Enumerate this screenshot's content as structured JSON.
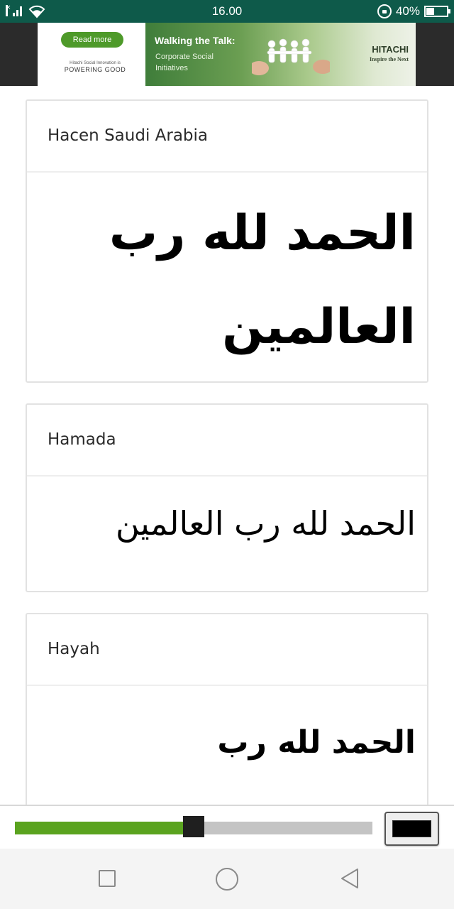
{
  "status_bar": {
    "time": "16.00",
    "battery_percent": "40%",
    "battery_level": 0.4,
    "icons": [
      "signal-icon",
      "wifi-icon",
      "rotation-lock-icon",
      "battery-icon"
    ]
  },
  "ad": {
    "read_more": "Read more",
    "tagline": "Hitachi Social Innovation is",
    "powering": "POWERING GOOD",
    "headline": "Walking the Talk:",
    "subline": "Corporate Social Initiatives",
    "brand": "HITACHI",
    "brand_tag": "Inspire the Next"
  },
  "cards": [
    {
      "title": "Hacen Saudi Arabia",
      "sample": "الحمد لله رب العالمين"
    },
    {
      "title": "Hamada",
      "sample": "الحمد لله رب العالمين"
    },
    {
      "title": "Hayah",
      "sample": "الحمد لله رب"
    }
  ],
  "controls": {
    "font_size_slider_value": 0.5,
    "text_color": "#000000",
    "accent_color": "#5aa31f"
  },
  "nav": {
    "icons": [
      "recent-apps-icon",
      "home-icon",
      "back-icon"
    ]
  }
}
